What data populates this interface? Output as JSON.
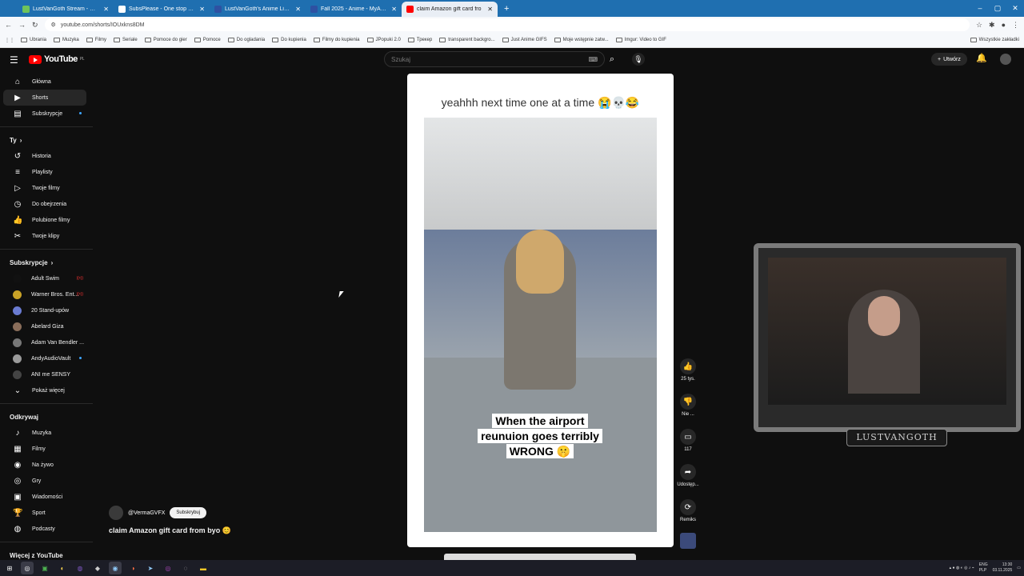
{
  "browser": {
    "tabs": [
      {
        "title": "LustVanGoth Stream - Watch L",
        "favicon": "#6fc35b",
        "active": false
      },
      {
        "title": "SubsPlease - One stop shop fo",
        "favicon": "#ffffff",
        "active": false
      },
      {
        "title": "LustVanGoth's Anime List - My",
        "favicon": "#2e51a2",
        "active": false
      },
      {
        "title": "Fall 2025 - Anime - MyAnimeL",
        "favicon": "#2e51a2",
        "active": false
      },
      {
        "title": "claim Amazon gift card fro",
        "favicon": "#ff0000",
        "active": true
      }
    ],
    "url": "youtube.com/shorts/IOUxkns8DM",
    "bookmarks": [
      "Ubrania",
      "Muzyka",
      "Filmy",
      "Seriale",
      "Pomoce do gier",
      "Pomoce",
      "Do ogladania",
      "Do kupienia",
      "Filmy do kupienia",
      "JPopuki 2.0",
      "Трекер",
      "transparent backgro...",
      "Just Anime GIFS",
      "Moje wstępnie zatw...",
      "Imgur: Video to GIF"
    ],
    "all_bookmarks": "Wszystkie zakładki"
  },
  "youtube": {
    "logo": "YouTube",
    "region": "PL",
    "search_placeholder": "Szukaj",
    "create_label": "Utwórz",
    "sidebar": {
      "main": [
        {
          "label": "Główna",
          "icon": "home-icon",
          "glyph": "⌂"
        },
        {
          "label": "Shorts",
          "icon": "shorts-icon",
          "glyph": "▶",
          "active": true
        },
        {
          "label": "Subskrypcje",
          "icon": "subscriptions-icon",
          "glyph": "▤",
          "dot": true
        }
      ],
      "you_header": "Ty",
      "you": [
        {
          "label": "Historia",
          "icon": "history-icon",
          "glyph": "↺"
        },
        {
          "label": "Playlisty",
          "icon": "playlists-icon",
          "glyph": "≡"
        },
        {
          "label": "Twoje filmy",
          "icon": "your-videos-icon",
          "glyph": "▷"
        },
        {
          "label": "Do obejrzenia",
          "icon": "watch-later-icon",
          "glyph": "◷"
        },
        {
          "label": "Polubione filmy",
          "icon": "liked-icon",
          "glyph": "👍"
        },
        {
          "label": "Twoje klipy",
          "icon": "clips-icon",
          "glyph": "✂"
        }
      ],
      "subs_header": "Subskrypcje",
      "subs": [
        {
          "label": "Adult Swim",
          "color": "#111111",
          "live": "((•))"
        },
        {
          "label": "Warner Bros. Ent...",
          "color": "#c9a227",
          "live": "((•))"
        },
        {
          "label": "20 Stand-upów",
          "color": "#6a7bd1"
        },
        {
          "label": "Abelard Giza",
          "color": "#8a6d5a"
        },
        {
          "label": "Adam Van Bendler ...",
          "color": "#777777"
        },
        {
          "label": "AndyAudioVault",
          "color": "#9a9a9a",
          "dot": true
        },
        {
          "label": "ANI me SENSY",
          "color": "#444444"
        }
      ],
      "show_more": "Pokaż więcej",
      "explore_header": "Odkrywaj",
      "explore": [
        {
          "label": "Muzyka",
          "icon": "music-icon",
          "glyph": "♪"
        },
        {
          "label": "Filmy",
          "icon": "movies-icon",
          "glyph": "▦"
        },
        {
          "label": "Na żywo",
          "icon": "live-icon",
          "glyph": "◉"
        },
        {
          "label": "Gry",
          "icon": "gaming-icon",
          "glyph": "◎"
        },
        {
          "label": "Wiadomości",
          "icon": "news-icon",
          "glyph": "▣"
        },
        {
          "label": "Sport",
          "icon": "sports-icon",
          "glyph": "🏆"
        },
        {
          "label": "Podcasty",
          "icon": "podcasts-icon",
          "glyph": "◍"
        }
      ],
      "more_header": "Więcej z YouTube"
    },
    "short": {
      "caption": "yeahhh next time one at a time 😭💀😂",
      "subtitle_lines": [
        "When the airport",
        "reunuion goes terribly",
        "WRONG 🤫"
      ],
      "actions": [
        {
          "label": "25 tys.",
          "icon": "like-icon",
          "glyph": "👍"
        },
        {
          "label": "Nie ...",
          "icon": "dislike-icon",
          "glyph": "👎"
        },
        {
          "label": "117",
          "icon": "comments-icon",
          "glyph": "▭"
        },
        {
          "label": "Udostęp...",
          "icon": "share-icon",
          "glyph": "➦"
        },
        {
          "label": "Remiks",
          "icon": "remix-icon",
          "glyph": "⟳"
        }
      ],
      "channel": "@VermaGVFX",
      "subscribe": "Subskrybuj",
      "title": "claim Amazon gift card from byo 😊"
    }
  },
  "overlay": {
    "webcam_label": "LUSTVANGOTH"
  },
  "taskbar": {
    "lang": "ENG",
    "lang2": "PLP",
    "time": "13:30",
    "date": "03.11.2025"
  }
}
